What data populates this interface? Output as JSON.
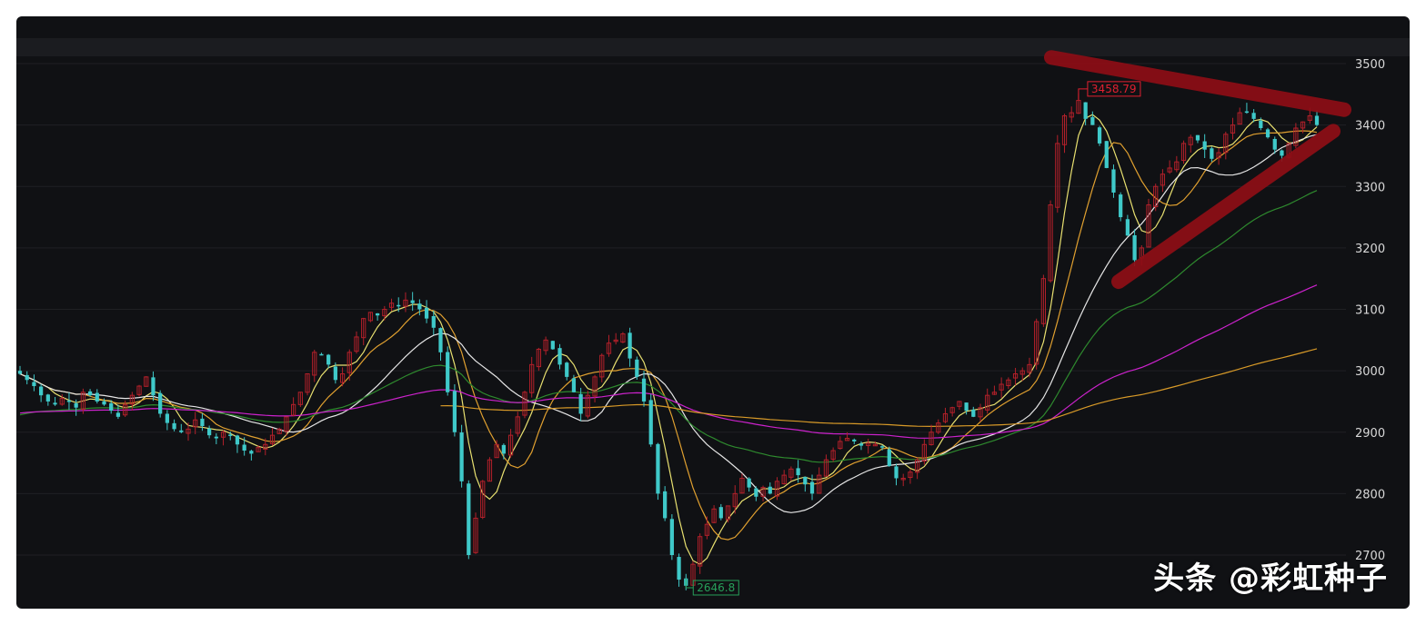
{
  "chart_data": {
    "type": "candlestick",
    "title": "",
    "xlabel": "",
    "ylabel": "",
    "ylim": [
      2640,
      3520
    ],
    "y_ticks": [
      3500,
      3400,
      3300,
      3200,
      3100,
      3000,
      2900,
      2800,
      2700
    ],
    "y_tick_labels": [
      "3500",
      "3400",
      "3300",
      "3200",
      "3100",
      "3000",
      "2900",
      "2800",
      "2700"
    ],
    "grid": true,
    "up_color": "#b3202a",
    "down_color": "#3fc9c9",
    "annotations": [
      {
        "label": "3458.79",
        "value": 3458.79,
        "kind": "high",
        "color": "#e02030"
      },
      {
        "label": "2646.8",
        "value": 2646.8,
        "kind": "low",
        "color": "#27a05a"
      }
    ],
    "trendlines": [
      {
        "name": "upper",
        "from": 3510,
        "to": 3425,
        "color": "#8e0e16"
      },
      {
        "name": "lower",
        "from": 3145,
        "to": 3390,
        "color": "#8e0e16"
      }
    ],
    "series_closes": [
      2995,
      2985,
      2975,
      2960,
      2950,
      2945,
      2955,
      2950,
      2940,
      2965,
      2960,
      2950,
      2945,
      2935,
      2925,
      2945,
      2960,
      2975,
      2990,
      2960,
      2930,
      2915,
      2905,
      2900,
      2905,
      2920,
      2910,
      2895,
      2890,
      2900,
      2895,
      2880,
      2870,
      2865,
      2875,
      2880,
      2895,
      2905,
      2925,
      2945,
      2965,
      2995,
      3030,
      3025,
      3010,
      2985,
      2995,
      3030,
      3055,
      3085,
      3095,
      3090,
      3100,
      3110,
      3105,
      3115,
      3110,
      3100,
      3085,
      3070,
      3030,
      2965,
      2900,
      2820,
      2700,
      2760,
      2820,
      2855,
      2880,
      2865,
      2895,
      2925,
      2965,
      3010,
      3035,
      3050,
      3035,
      3010,
      2990,
      2965,
      2930,
      2960,
      2990,
      3025,
      3045,
      3050,
      3060,
      3020,
      2990,
      2950,
      2880,
      2800,
      2760,
      2700,
      2660,
      2650,
      2685,
      2730,
      2750,
      2775,
      2760,
      2780,
      2800,
      2825,
      2810,
      2795,
      2810,
      2800,
      2820,
      2830,
      2840,
      2830,
      2815,
      2800,
      2830,
      2855,
      2870,
      2885,
      2890,
      2885,
      2878,
      2882,
      2880,
      2875,
      2845,
      2825,
      2825,
      2835,
      2855,
      2880,
      2900,
      2915,
      2930,
      2940,
      2950,
      2935,
      2925,
      2940,
      2960,
      2965,
      2978,
      2985,
      2995,
      3000,
      3010,
      3080,
      3150,
      3270,
      3370,
      3415,
      3420,
      3440,
      3410,
      3400,
      3370,
      3330,
      3290,
      3250,
      3220,
      3180,
      3200,
      3270,
      3300,
      3320,
      3330,
      3340,
      3370,
      3380,
      3375,
      3360,
      3345,
      3355,
      3385,
      3400,
      3420,
      3420,
      3410,
      3395,
      3380,
      3360,
      3350,
      3370,
      3395,
      3405,
      3415,
      3400
    ],
    "moving_averages": [
      {
        "name": "MA5",
        "color": "#e8e070"
      },
      {
        "name": "MA10",
        "color": "#e0a030"
      },
      {
        "name": "MA20",
        "color": "#e6e6e6"
      },
      {
        "name": "MA60",
        "color": "#2e8a2e"
      },
      {
        "name": "MA120",
        "color": "#cc22cc"
      },
      {
        "name": "MA250",
        "color": "#d89a28"
      }
    ]
  },
  "watermark": "头条 @彩虹种子"
}
